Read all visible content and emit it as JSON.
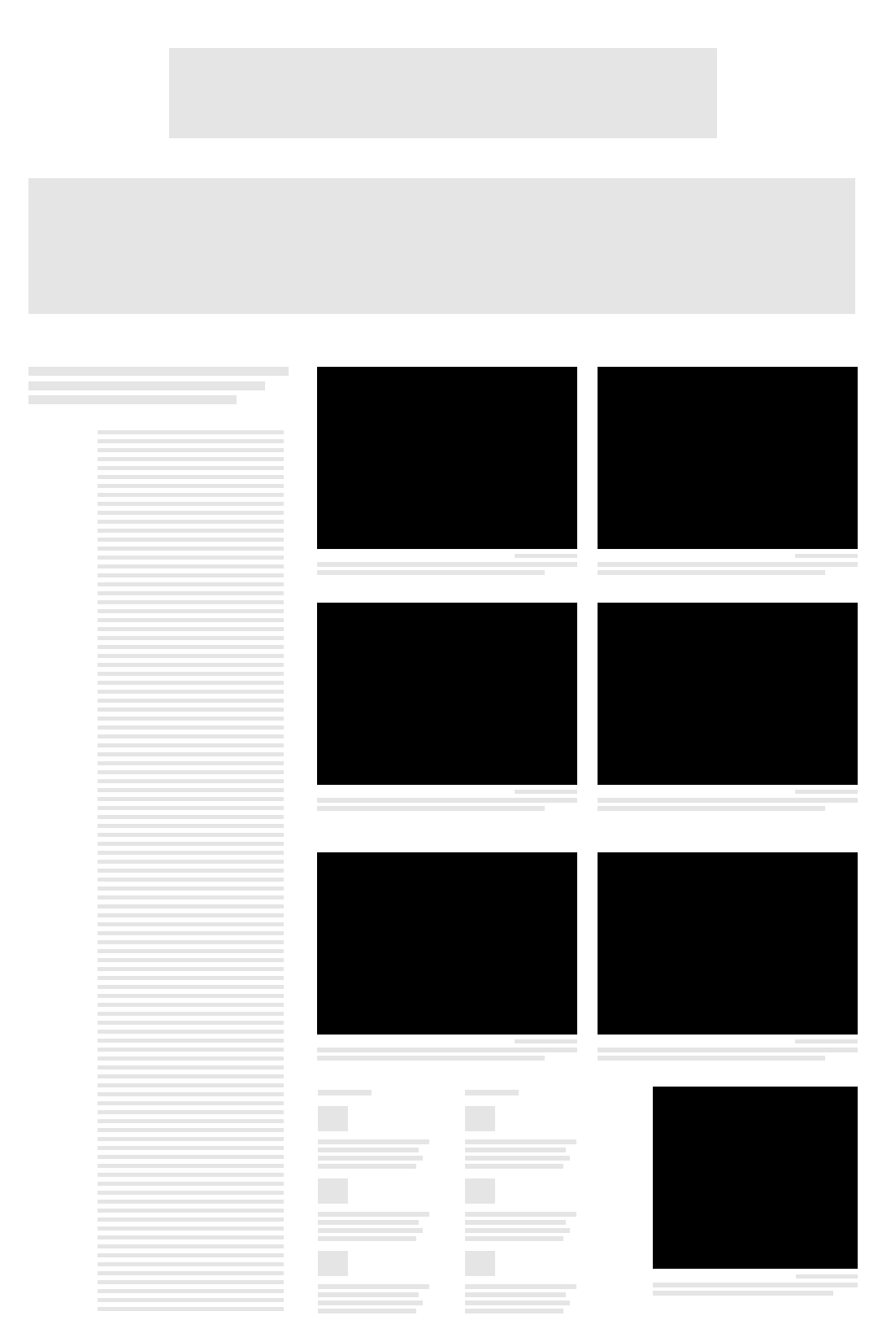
{
  "page": {
    "background": "#ffffff",
    "placeholder_color": "#e5e5e6",
    "media_color": "#000000"
  },
  "header": {
    "banner_label": ""
  },
  "hero": {
    "label": ""
  },
  "article": {
    "title": "",
    "body": ""
  },
  "gallery": {
    "items": [
      {
        "caption": "",
        "credit": ""
      },
      {
        "caption": "",
        "credit": ""
      },
      {
        "caption": "",
        "credit": ""
      },
      {
        "caption": "",
        "credit": ""
      },
      {
        "caption": "",
        "credit": ""
      },
      {
        "caption": "",
        "credit": ""
      }
    ]
  },
  "related": {
    "columns": [
      {
        "heading": "",
        "items": [
          {
            "text": ""
          },
          {
            "text": ""
          },
          {
            "text": ""
          }
        ]
      },
      {
        "heading": "",
        "items": [
          {
            "text": ""
          },
          {
            "text": ""
          },
          {
            "text": ""
          }
        ]
      }
    ]
  },
  "feature": {
    "caption": "",
    "credit": ""
  }
}
